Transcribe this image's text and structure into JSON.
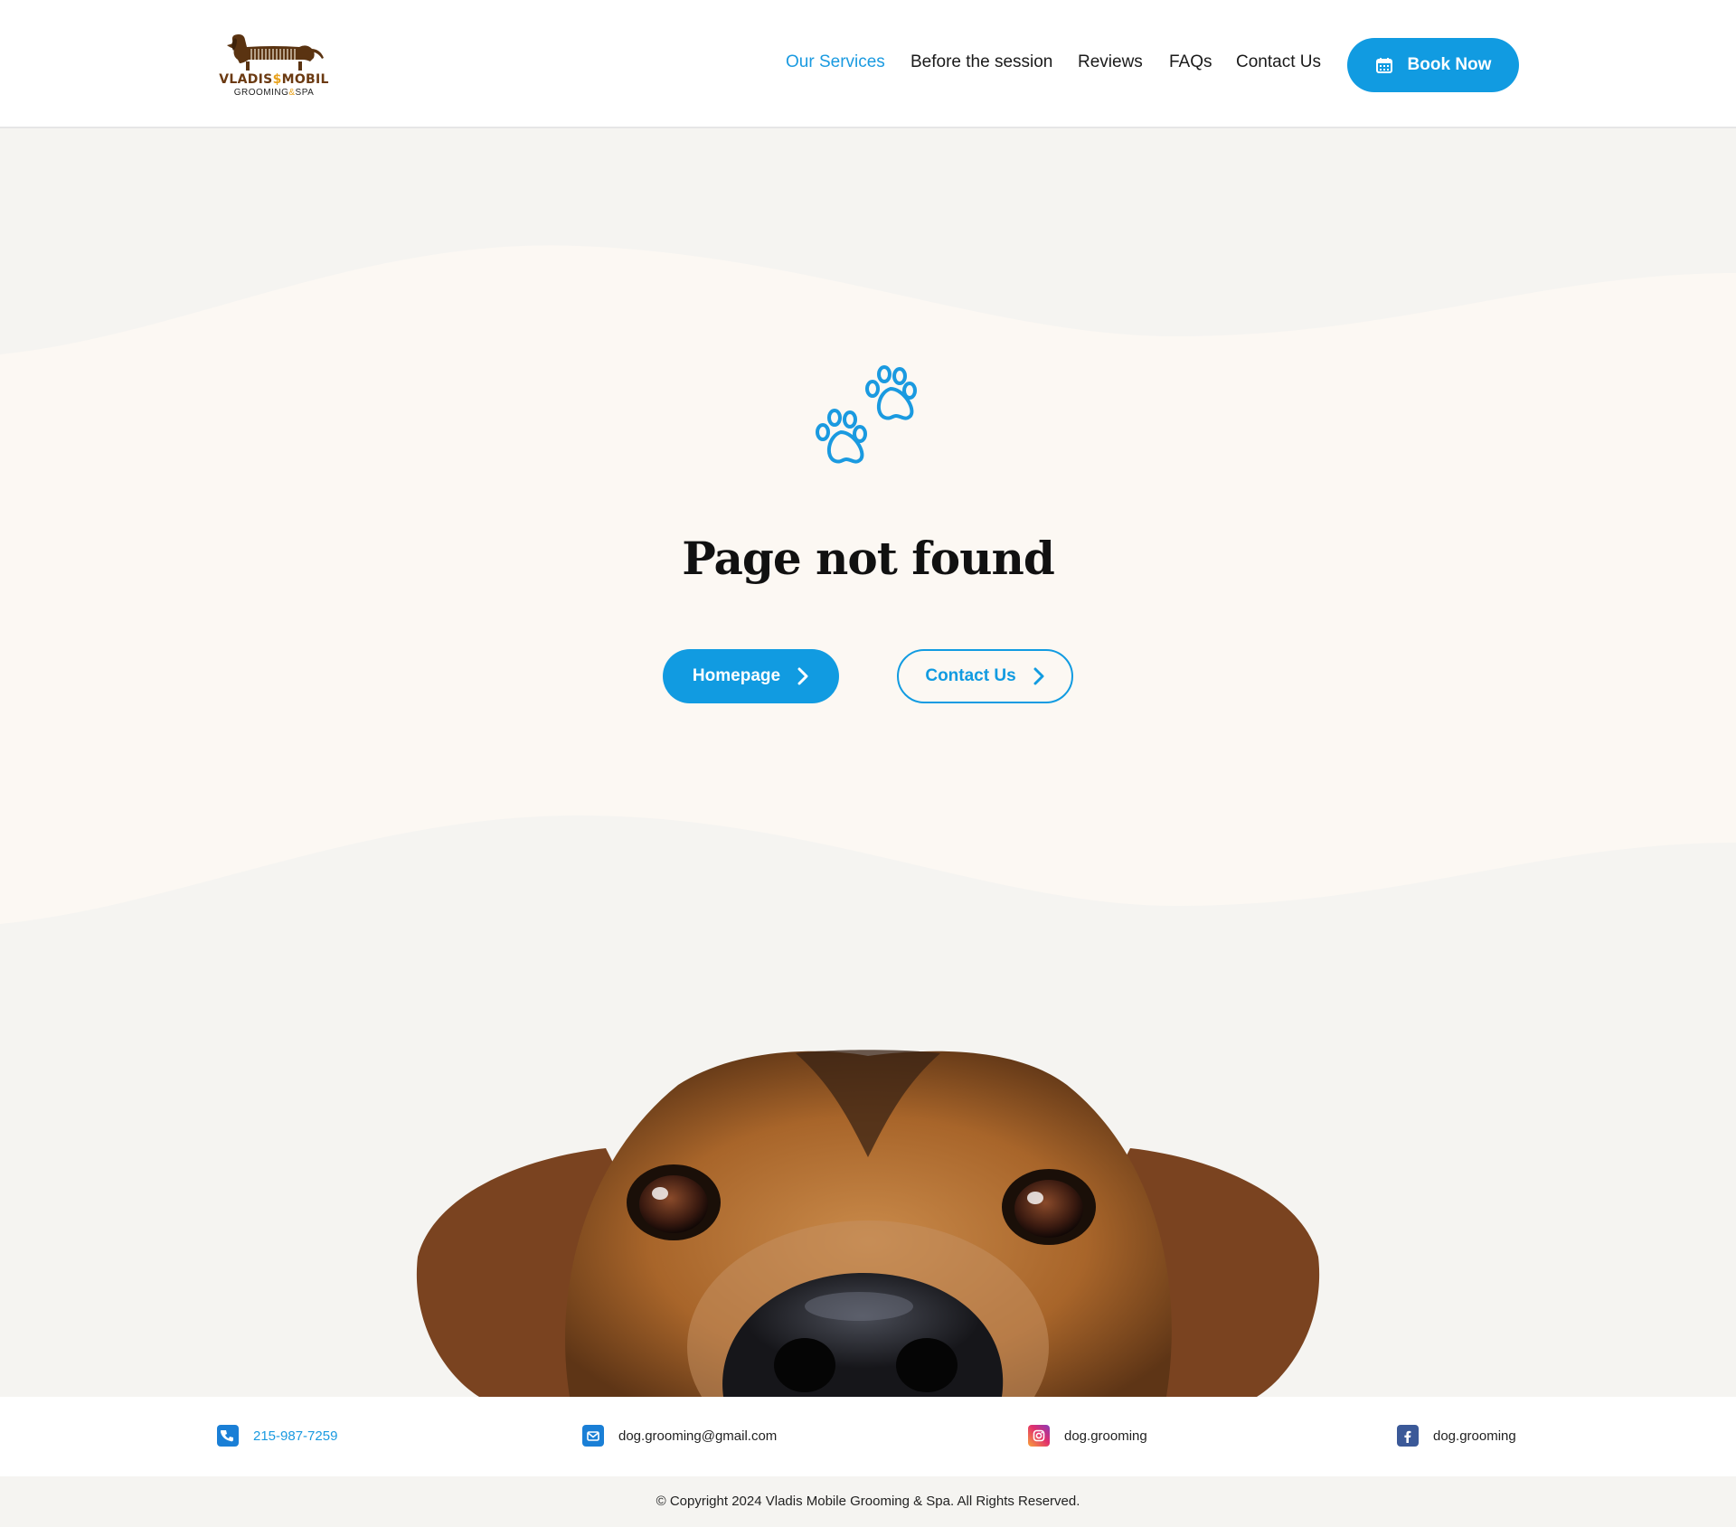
{
  "header": {
    "logo": {
      "name": "VLADIS$MOBIL",
      "name_part1": "VLADIS",
      "name_symbol": "$",
      "name_part2": "MOBIL",
      "sub_part1": "GROOMING",
      "sub_amp": "&",
      "sub_part2": "SPA"
    },
    "nav": [
      {
        "label": "Our Services",
        "active": true
      },
      {
        "label": "Before the session",
        "active": false
      },
      {
        "label": "Reviews",
        "active": false
      },
      {
        "label": "FAQs",
        "active": false
      },
      {
        "label": "Contact Us",
        "active": false
      }
    ],
    "book_button": {
      "label": "Book Now",
      "icon": "calendar-icon"
    }
  },
  "main": {
    "icon": "paw-prints-icon",
    "title": "Page not found",
    "buttons": {
      "homepage": {
        "label": "Homepage",
        "icon": "chevron-right-icon"
      },
      "contact": {
        "label": "Contact Us",
        "icon": "chevron-right-icon"
      }
    }
  },
  "footer": {
    "phone": {
      "icon": "phone-icon",
      "text": "215-987-7259"
    },
    "email": {
      "icon": "mail-icon",
      "text": "dog.grooming@gmail.com"
    },
    "instagram": {
      "icon": "instagram-icon",
      "text": "dog.grooming"
    },
    "facebook": {
      "icon": "facebook-icon",
      "text": "dog.grooming"
    },
    "copyright": "© Copyright 2024 Vladis Mobile Grooming & Spa. All Rights Reserved."
  },
  "colors": {
    "accent": "#119be1",
    "page_bg": "#f5f4f1",
    "wave_bg": "#fcf8f3",
    "logo_brown": "#6b3a12",
    "logo_gold": "#e9a21b"
  }
}
